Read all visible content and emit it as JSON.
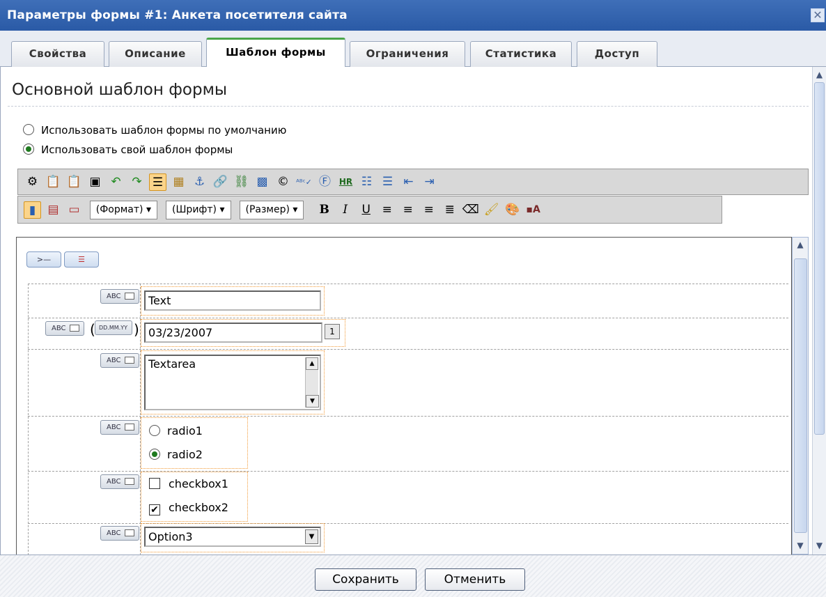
{
  "window": {
    "title": "Параметры формы #1: Анкета посетителя сайта"
  },
  "tabs": [
    {
      "label": "Свойства"
    },
    {
      "label": "Описание"
    },
    {
      "label": "Шаблон формы",
      "active": true
    },
    {
      "label": "Ограничения"
    },
    {
      "label": "Статистика"
    },
    {
      "label": "Доступ"
    }
  ],
  "section": {
    "title": "Основной шаблон формы"
  },
  "template_options": [
    {
      "label": "Использовать шаблон формы по умолчанию",
      "selected": false
    },
    {
      "label": "Использовать свой шаблон формы",
      "selected": true
    }
  ],
  "toolbar2": {
    "format": "(Формат)",
    "font": "(Шрифт)",
    "size": "(Размер)"
  },
  "form": {
    "text_value": "Text",
    "date_badge": "DD.MM.YY",
    "date_value": "03/23/2007",
    "calendar_label": "1",
    "textarea_value": "Textarea",
    "radios": [
      {
        "label": "radio1",
        "checked": false
      },
      {
        "label": "radio2",
        "checked": true
      }
    ],
    "checkboxes": [
      {
        "label": "checkbox1",
        "checked": false
      },
      {
        "label": "checkbox2",
        "checked": true
      }
    ],
    "select_value": "Option3",
    "field_tag": "ABC"
  },
  "footer": {
    "save": "Сохранить",
    "cancel": "Отменить"
  },
  "colors": {
    "title_bg": "#2a5aa6",
    "active_tab_accent": "#4aa64a",
    "field_outline": "#f29b38"
  }
}
